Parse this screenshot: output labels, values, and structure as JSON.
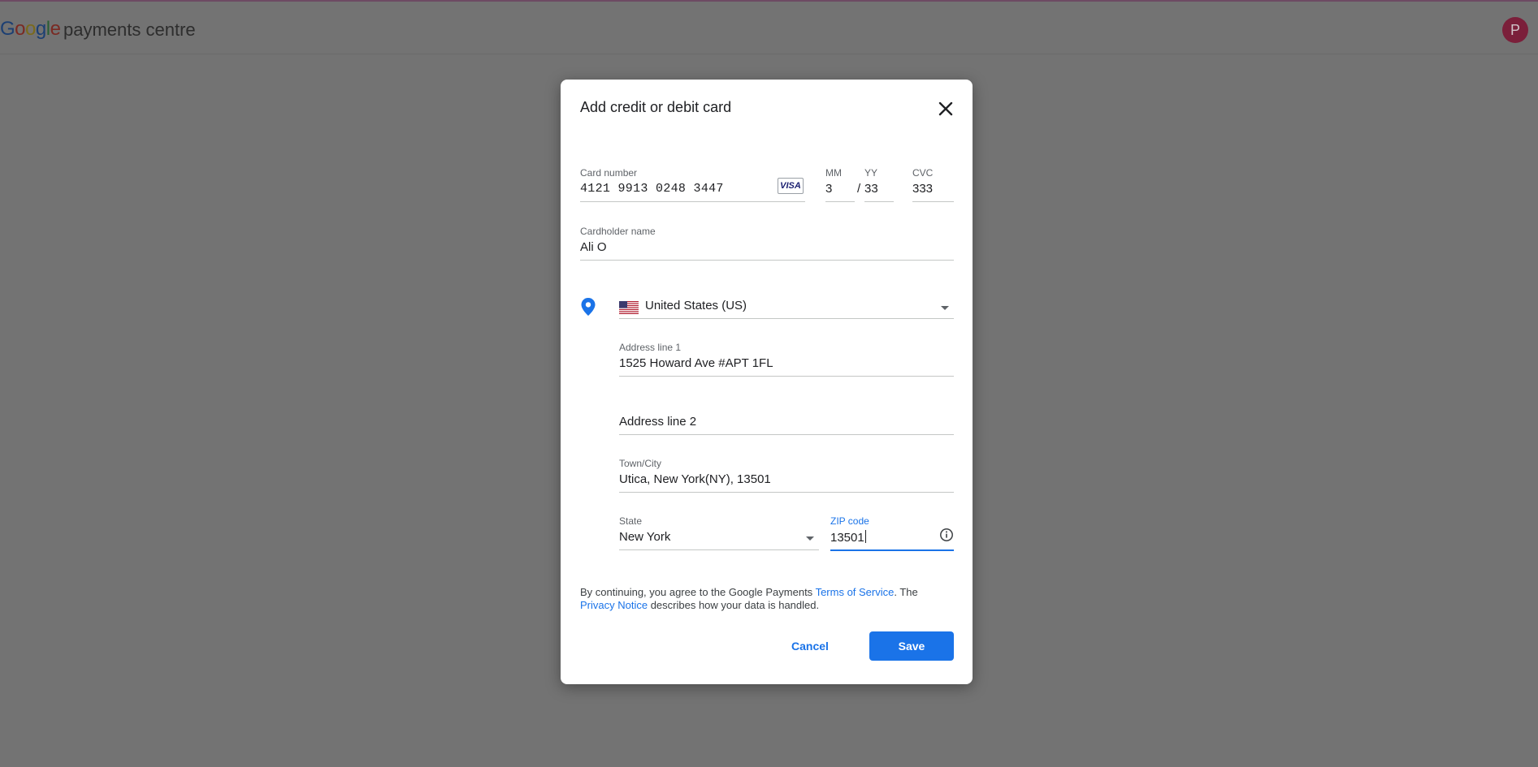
{
  "header": {
    "logo_letters": [
      "G",
      "o",
      "o",
      "g",
      "l",
      "e"
    ],
    "product_name": "payments centre",
    "avatar_initial": "P"
  },
  "dialog": {
    "title": "Add credit or debit card",
    "card_number": {
      "label": "Card number",
      "value": "4121 9913 0248 3447",
      "brand": "VISA"
    },
    "expiry_month": {
      "label": "MM",
      "value": "3"
    },
    "expiry_year": {
      "label": "YY",
      "value": "33"
    },
    "expiry_separator": "/",
    "cvc": {
      "label": "CVC",
      "value": "333"
    },
    "cardholder_name": {
      "label": "Cardholder name",
      "value": "Ali O"
    },
    "country": {
      "value": "United States (US)"
    },
    "address_line1": {
      "label": "Address line 1",
      "value": "1525 Howard Ave #APT 1FL"
    },
    "address_line2": {
      "placeholder": "Address line 2"
    },
    "town_city": {
      "label": "Town/City",
      "value": "Utica, New York(NY), 13501"
    },
    "state": {
      "label": "State",
      "value": "New York"
    },
    "zip_code": {
      "label": "ZIP code",
      "value": "13501"
    },
    "terms": {
      "text_before": "By continuing, you agree to the Google Payments ",
      "terms_link": "Terms of Service",
      "text_middle": ". The ",
      "privacy_link": "Privacy Notice",
      "text_after": " describes how your data is handled."
    },
    "cancel_label": "Cancel",
    "save_label": "Save"
  },
  "colors": {
    "overlay": "#737373",
    "accent": "#1a73e8",
    "avatar": "#7b1f3a",
    "location_pin": "#1a73e8"
  },
  "icons": [
    "close-icon",
    "visa-card-icon",
    "location-pin-icon",
    "us-flag-icon",
    "dropdown-caret-icon",
    "info-icon"
  ]
}
